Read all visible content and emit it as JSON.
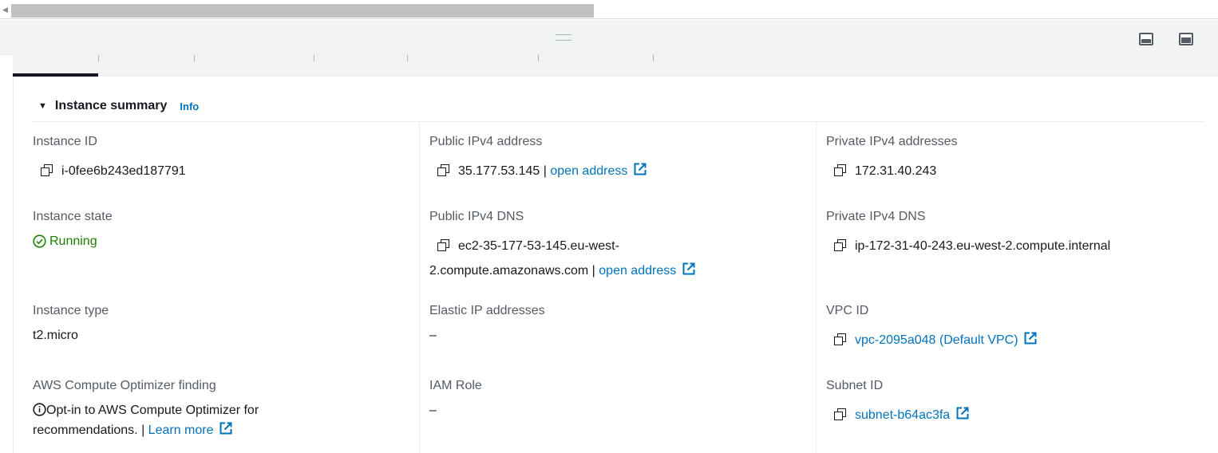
{
  "panel": {
    "summary_title": "Instance summary",
    "info_label": "Info"
  },
  "columns": [
    {
      "fields": [
        {
          "label": "Instance ID",
          "value": "i-0fee6b243ed187791"
        },
        {
          "label": "Instance state",
          "value": "Running"
        },
        {
          "label": "Instance type",
          "value": "t2.micro"
        },
        {
          "label": "AWS Compute Optimizer finding",
          "value_line1": "Opt-in to AWS Compute Optimizer for",
          "value_line2": "recommendations. |",
          "link": "Learn more"
        }
      ]
    },
    {
      "fields": [
        {
          "label": "Public IPv4 address",
          "value": "35.177.53.145 |",
          "link": "open address"
        },
        {
          "label": "Public IPv4 DNS",
          "value_line1": "ec2-35-177-53-145.eu-west-",
          "value_line2": "2.compute.amazonaws.com |",
          "link": "open address"
        },
        {
          "label": "Elastic IP addresses",
          "value": "–"
        },
        {
          "label": "IAM Role",
          "value": "–"
        }
      ]
    },
    {
      "fields": [
        {
          "label": "Private IPv4 addresses",
          "value": "172.31.40.243"
        },
        {
          "label": "Private IPv4 DNS",
          "value": "ip-172-31-40-243.eu-west-2.compute.internal"
        },
        {
          "label": "VPC ID",
          "link": "vpc-2095a048 (Default VPC)"
        },
        {
          "label": "Subnet ID",
          "link": "subnet-b64ac3fa"
        }
      ]
    }
  ],
  "colors": {
    "link": "#0073bb",
    "running": "#1d8102",
    "label": "#545b64"
  },
  "icons": [
    "copy-icon",
    "external-link-icon",
    "check-circle-icon",
    "info-circle-icon",
    "caret-down-icon",
    "drag-handle-icon",
    "panel-bottom-icon",
    "panel-side-icon"
  ]
}
